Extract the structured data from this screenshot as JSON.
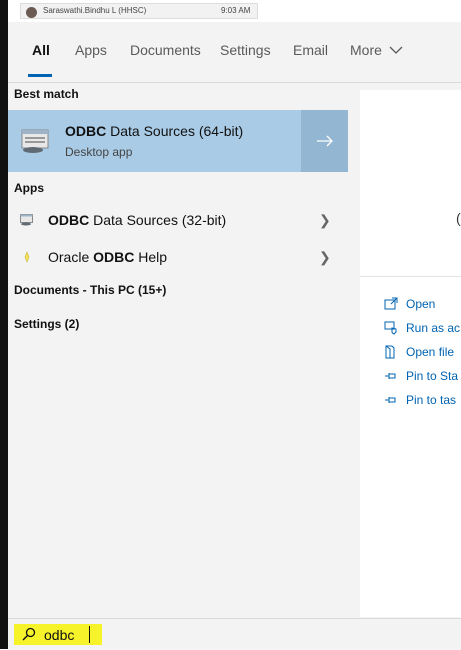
{
  "notification": {
    "user": "Saraswathi.Bindhu L (HHSC)",
    "time": "9:03 AM"
  },
  "tabs": [
    "All",
    "Apps",
    "Documents",
    "Settings",
    "Email",
    "More"
  ],
  "sections": {
    "best_match": "Best match",
    "apps": "Apps",
    "documents": "Documents - This PC (15+)",
    "settings": "Settings (2)"
  },
  "best_match": {
    "title_bold": "ODBC",
    "title_rest": " Data Sources (64-bit)",
    "subtitle": "Desktop app"
  },
  "apps": [
    {
      "bold": "ODBC",
      "rest": " Data Sources (32-bit)"
    },
    {
      "pre": "Oracle ",
      "bold": "ODBC",
      "rest": " Help"
    }
  ],
  "preview": {
    "title_fragment": "(",
    "actions": [
      {
        "icon": "open-icon",
        "label": "Open"
      },
      {
        "icon": "run-as-admin-icon",
        "label": "Run as ac"
      },
      {
        "icon": "open-file-location-icon",
        "label": "Open file"
      },
      {
        "icon": "pin-icon",
        "label": "Pin to Sta"
      },
      {
        "icon": "pin-icon",
        "label": "Pin to tas"
      }
    ]
  },
  "search": {
    "value": "odbc"
  },
  "colors": {
    "accent": "#0063b1",
    "selected": "#a9cbe6",
    "highlight": "#f7f32a"
  }
}
